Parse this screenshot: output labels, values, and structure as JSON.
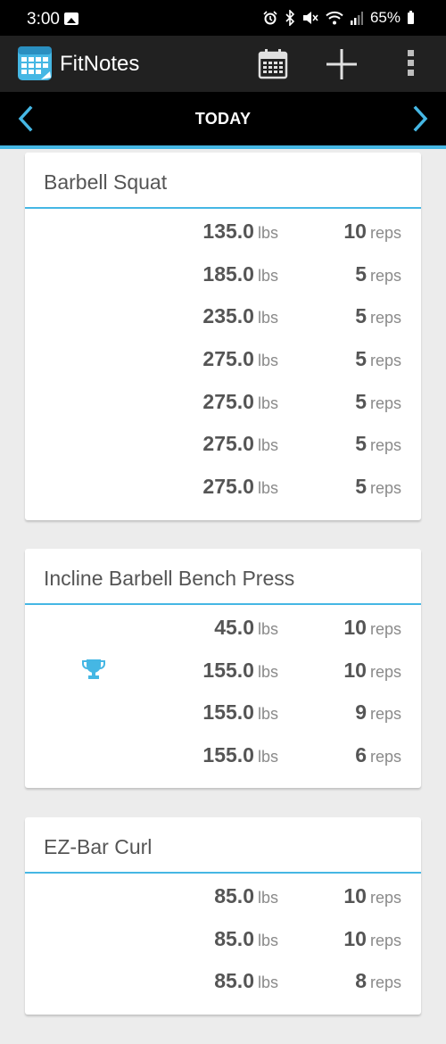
{
  "status_bar": {
    "time": "3:00",
    "battery": "65%"
  },
  "app_bar": {
    "title": "FitNotes"
  },
  "date_nav": {
    "label": "TODAY"
  },
  "colors": {
    "accent": "#45b7e4",
    "app_bar_bg": "#212121",
    "date_bar_bg": "#000000",
    "background": "#ececec"
  },
  "workouts": [
    {
      "name": "Barbell Squat",
      "sets": [
        {
          "weight": "135.0",
          "weight_unit": "lbs",
          "reps": "10",
          "reps_unit": "reps"
        },
        {
          "weight": "185.0",
          "weight_unit": "lbs",
          "reps": "5",
          "reps_unit": "reps"
        },
        {
          "weight": "235.0",
          "weight_unit": "lbs",
          "reps": "5",
          "reps_unit": "reps"
        },
        {
          "weight": "275.0",
          "weight_unit": "lbs",
          "reps": "5",
          "reps_unit": "reps"
        },
        {
          "weight": "275.0",
          "weight_unit": "lbs",
          "reps": "5",
          "reps_unit": "reps"
        },
        {
          "weight": "275.0",
          "weight_unit": "lbs",
          "reps": "5",
          "reps_unit": "reps"
        },
        {
          "weight": "275.0",
          "weight_unit": "lbs",
          "reps": "5",
          "reps_unit": "reps"
        }
      ]
    },
    {
      "name": "Incline Barbell Bench Press",
      "sets": [
        {
          "weight": "45.0",
          "weight_unit": "lbs",
          "reps": "10",
          "reps_unit": "reps"
        },
        {
          "weight": "155.0",
          "weight_unit": "lbs",
          "reps": "10",
          "reps_unit": "reps",
          "record": true
        },
        {
          "weight": "155.0",
          "weight_unit": "lbs",
          "reps": "9",
          "reps_unit": "reps"
        },
        {
          "weight": "155.0",
          "weight_unit": "lbs",
          "reps": "6",
          "reps_unit": "reps"
        }
      ]
    },
    {
      "name": "EZ-Bar Curl",
      "sets": [
        {
          "weight": "85.0",
          "weight_unit": "lbs",
          "reps": "10",
          "reps_unit": "reps"
        },
        {
          "weight": "85.0",
          "weight_unit": "lbs",
          "reps": "10",
          "reps_unit": "reps"
        },
        {
          "weight": "85.0",
          "weight_unit": "lbs",
          "reps": "8",
          "reps_unit": "reps"
        }
      ]
    }
  ]
}
